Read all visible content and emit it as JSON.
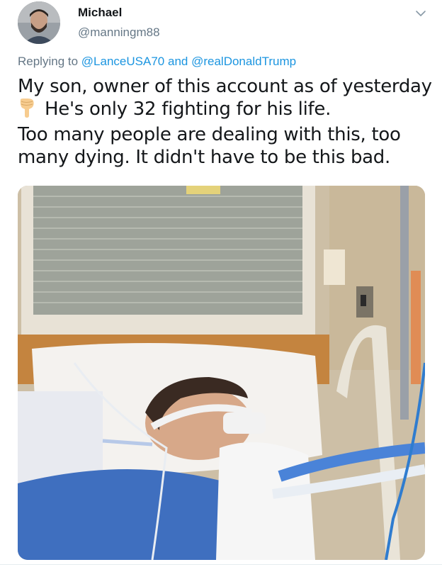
{
  "tweet": {
    "display_name": "Michael",
    "handle": "@manningm88",
    "reply": {
      "prefix": "Replying to",
      "mention_1": "@LanceUSA70",
      "joiner": "and",
      "mention_2": "@realDonaldTrump"
    },
    "text_lines": [
      "My son, owner of this account as of yesterday",
      "He's only 32 fighting for his life.",
      "Too many people are dealing with this, too",
      "many dying. It didn't have to be this bad."
    ],
    "emoji": "backhand-index-pointing-down",
    "media": {
      "description_icon": "photo"
    },
    "colors": {
      "link": "#1b95e0",
      "secondary": "#657786",
      "text": "#14171a"
    }
  }
}
